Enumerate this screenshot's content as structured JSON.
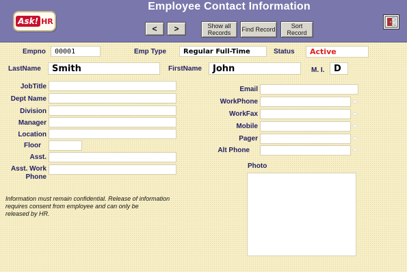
{
  "header": {
    "title": "Employee Contact Information",
    "logo_ask": "Ask!",
    "logo_hr": "HR",
    "prev_label": "<",
    "next_label": ">",
    "show_all_line1": "Show all",
    "show_all_line2": "Records",
    "find_record": "Find Record",
    "sort_line1": "Sort",
    "sort_line2": "Record",
    "exit_icon": "exit-door-icon"
  },
  "top": {
    "empno_label": "Empno",
    "empno_value": "00001",
    "emp_type_label": "Emp Type",
    "emp_type_value": "Regular Full-Time",
    "status_label": "Status",
    "status_value": "Active",
    "lastname_label": "LastName",
    "lastname_value": "Smith",
    "firstname_label": "FirstName",
    "firstname_value": "John",
    "mi_label": "M. I.",
    "mi_value": "D"
  },
  "left": {
    "jobtitle_label": "JobTitle",
    "dept_label": "Dept Name",
    "division_label": "Division",
    "manager_label": "Manager",
    "location_label": "Location",
    "floor_label": "Floor",
    "asst_label": "Asst.",
    "asst_work_label1": "Asst. Work",
    "asst_work_label2": "Phone"
  },
  "right": {
    "email_label": "Email",
    "workphone_label": "WorkPhone",
    "workfax_label": "WorkFax",
    "mobile_label": "Mobile",
    "pager_label": "Pager",
    "altphone_label": "Alt Phone",
    "photo_label": "Photo"
  },
  "notice": {
    "line1": "Information must remain confidential.  Release of information",
    "line2": "requires consent from employee and can only be",
    "line3": "released by HR."
  },
  "colors": {
    "header_bg": "#7a77ad",
    "label_text": "#1f1f66",
    "status_active": "#e02020",
    "form_bg": "#f7efc6"
  }
}
